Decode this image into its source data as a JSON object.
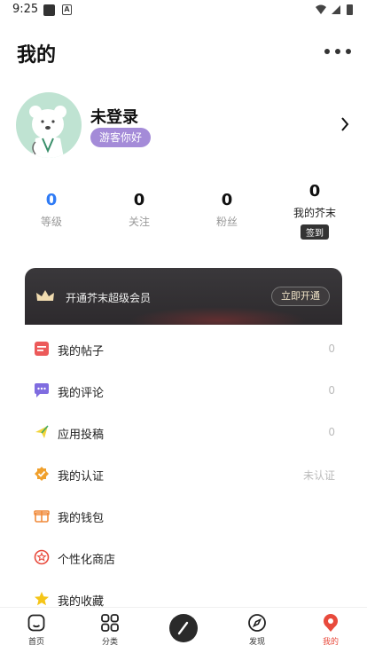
{
  "status_bar": {
    "time": "9:25",
    "notif_a": "A"
  },
  "header": {
    "title": "我的"
  },
  "profile": {
    "name": "未登录",
    "badge": "游客你好"
  },
  "stats": [
    {
      "value": "0",
      "label": "等级"
    },
    {
      "value": "0",
      "label": "关注"
    },
    {
      "value": "0",
      "label": "粉丝"
    },
    {
      "value": "0",
      "label": "我的芥末",
      "button": "签到"
    }
  ],
  "vip": {
    "text": "开通芥末超级会员",
    "button": "立即开通"
  },
  "menu": [
    {
      "label": "我的帖子",
      "value": "0",
      "icon": "post-icon"
    },
    {
      "label": "我的评论",
      "value": "0",
      "icon": "comment-icon"
    },
    {
      "label": "应用投稿",
      "value": "0",
      "icon": "submit-icon"
    },
    {
      "label": "我的认证",
      "value": "未认证",
      "icon": "verify-icon"
    },
    {
      "label": "我的钱包",
      "value": "",
      "icon": "wallet-icon"
    },
    {
      "label": "个性化商店",
      "value": "",
      "icon": "store-icon"
    },
    {
      "label": "我的收藏",
      "value": "",
      "icon": "favorite-icon"
    }
  ],
  "nav": [
    {
      "label": "首页",
      "icon": "home-icon"
    },
    {
      "label": "分类",
      "icon": "category-icon"
    },
    {
      "label": "发现",
      "icon": "discover-icon"
    },
    {
      "label": "我的",
      "icon": "profile-icon",
      "active": true
    }
  ],
  "colors": {
    "accent": "#e84a3c",
    "badge": "#a48bd8",
    "level": "#2f7bf5",
    "vip_bg": "#333033"
  }
}
